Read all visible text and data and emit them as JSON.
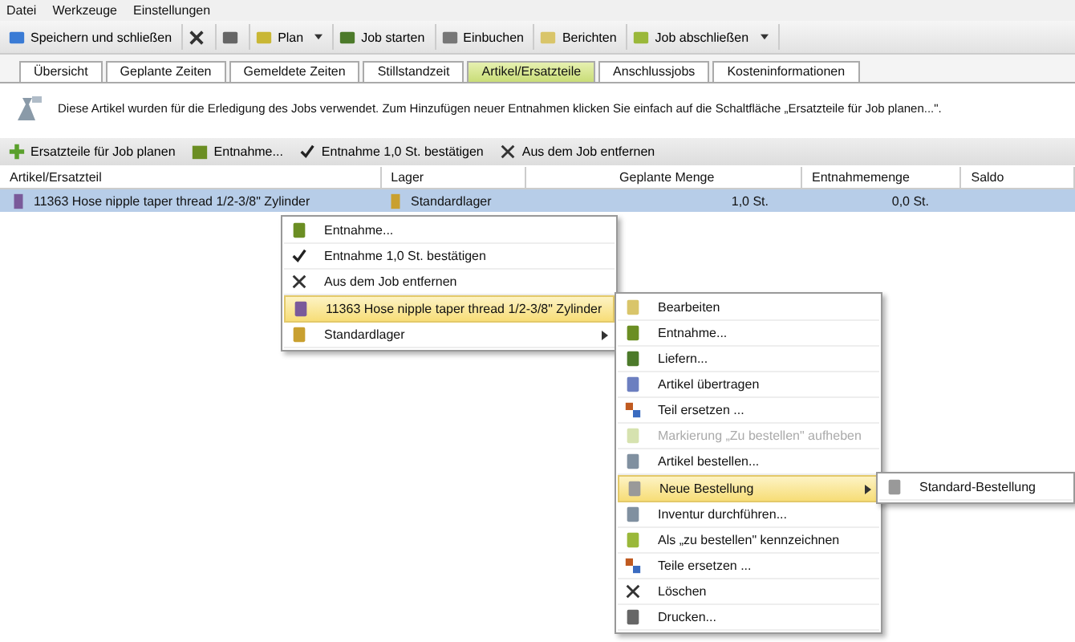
{
  "menu_bar": [
    "Datei",
    "Werkzeuge",
    "Einstellungen"
  ],
  "toolbar": [
    {
      "label": "Speichern und schließen",
      "dropdown": false
    },
    {
      "dropdown": false
    },
    {
      "dropdown": false
    },
    {
      "label": "Plan",
      "dropdown": true
    },
    {
      "label": "Job starten",
      "dropdown": false
    },
    {
      "label": "Einbuchen",
      "dropdown": false
    },
    {
      "label": "Berichten",
      "dropdown": false
    },
    {
      "label": "Job abschließen",
      "dropdown": true
    }
  ],
  "tabs": [
    {
      "label": "Übersicht",
      "selected": false
    },
    {
      "label": "Geplante Zeiten",
      "selected": false
    },
    {
      "label": "Gemeldete Zeiten",
      "selected": false
    },
    {
      "label": "Stillstandzeit",
      "selected": false
    },
    {
      "label": "Artikel/Ersatzteile",
      "selected": true
    },
    {
      "label": "Anschlussjobs",
      "selected": false
    },
    {
      "label": "Kosteninformationen",
      "selected": false
    }
  ],
  "info_text": "Diese Artikel wurden für die Erledigung des Jobs verwendet. Zum Hinzufügen neuer Entnahmen klicken Sie einfach auf die Schaltfläche „Ersatzteile für Job planen...\".",
  "actions": [
    "Ersatzteile für Job planen",
    "Entnahme...",
    "Entnahme 1,0 St. bestätigen",
    "Aus dem Job entfernen"
  ],
  "table": {
    "columns": [
      "Artikel/Ersatzteil",
      "Lager",
      "Geplante Menge",
      "Entnahmemenge",
      "Saldo"
    ],
    "rows": [
      {
        "selected": true,
        "cells": [
          "11363 Hose nipple taper thread 1/2-3/8\" Zylinder",
          "Standardlager",
          "1,0 St.",
          "0,0 St."
        ]
      }
    ]
  },
  "context_menu": [
    {
      "label": "Entnahme...",
      "submenu": false,
      "highlighted": false,
      "disabled": false
    },
    {
      "label": "Entnahme 1,0 St. bestätigen",
      "submenu": false,
      "highlighted": false,
      "disabled": false
    },
    {
      "label": "Aus dem Job entfernen",
      "submenu": false,
      "highlighted": false,
      "disabled": false
    },
    {
      "label": "11363 Hose nipple taper thread 1/2-3/8\" Zylinder",
      "submenu": true,
      "highlighted": true,
      "disabled": false
    },
    {
      "label": "Standardlager",
      "submenu": true,
      "highlighted": false,
      "disabled": false
    }
  ],
  "submenu": [
    {
      "label": "Bearbeiten",
      "submenu": false,
      "highlighted": false,
      "disabled": false
    },
    {
      "label": "Entnahme...",
      "submenu": false,
      "highlighted": false,
      "disabled": false
    },
    {
      "label": "Liefern...",
      "submenu": false,
      "highlighted": false,
      "disabled": false
    },
    {
      "label": "Artikel übertragen",
      "submenu": false,
      "highlighted": false,
      "disabled": false
    },
    {
      "label": "Teil ersetzen ...",
      "submenu": false,
      "highlighted": false,
      "disabled": false
    },
    {
      "label": "Markierung „Zu bestellen\" aufheben",
      "submenu": false,
      "highlighted": false,
      "disabled": true
    },
    {
      "label": "Artikel bestellen...",
      "submenu": false,
      "highlighted": false,
      "disabled": false
    },
    {
      "label": "Neue Bestellung",
      "submenu": true,
      "highlighted": true,
      "disabled": false
    },
    {
      "label": "Inventur durchführen...",
      "submenu": false,
      "highlighted": false,
      "disabled": false
    },
    {
      "label": "Als „zu bestellen\" kennzeichnen",
      "submenu": false,
      "highlighted": false,
      "disabled": false
    },
    {
      "label": "Teile ersetzen ...",
      "submenu": false,
      "highlighted": false,
      "disabled": false
    },
    {
      "label": "Löschen",
      "submenu": false,
      "highlighted": false,
      "disabled": false
    },
    {
      "label": "Drucken...",
      "submenu": false,
      "highlighted": false,
      "disabled": false
    }
  ],
  "sub_submenu": [
    {
      "label": "Standard-Bestellung",
      "submenu": false,
      "highlighted": false,
      "disabled": false
    }
  ]
}
